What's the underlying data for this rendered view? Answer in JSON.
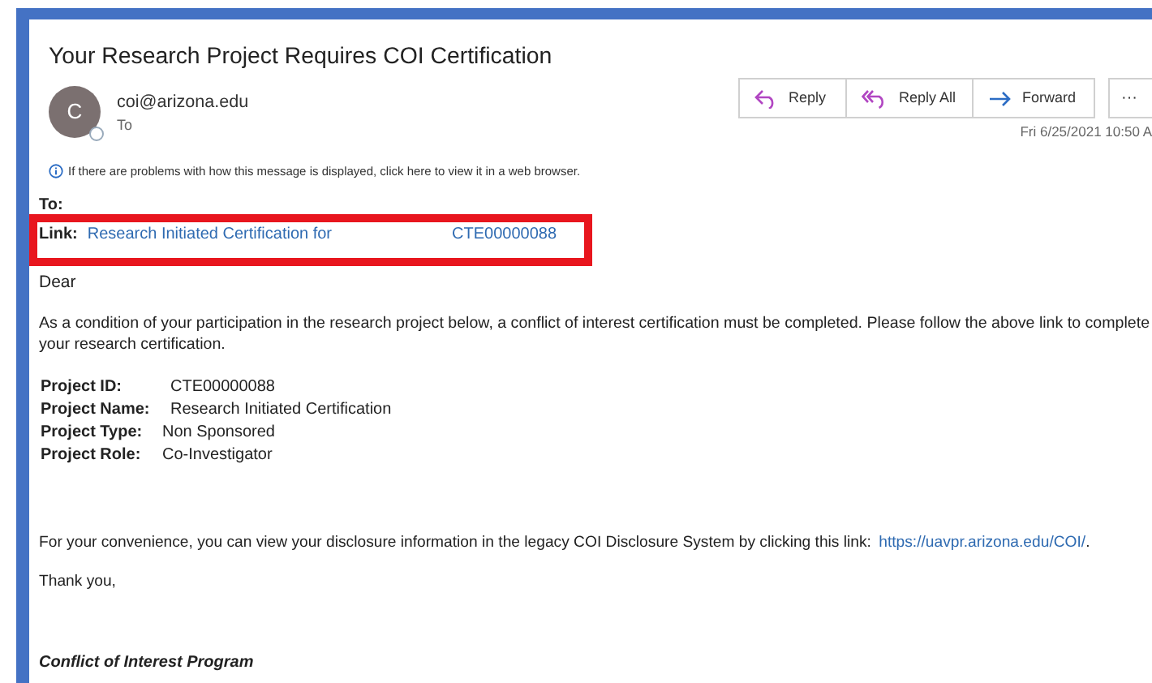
{
  "subject": "Your Research Project Requires COI Certification",
  "sender": {
    "initial": "C",
    "address": "coi@arizona.edu",
    "to_label": "To"
  },
  "actions": [
    {
      "kind": "reply",
      "label": "Reply"
    },
    {
      "kind": "reply_all",
      "label": "Reply All"
    },
    {
      "kind": "forward",
      "label": "Forward"
    }
  ],
  "more": "···",
  "date": "Fri 6/25/2021 10:50 A",
  "info_bar": "If there are problems with how this message is displayed, click here to view it in a web browser.",
  "to_field": {
    "label": "To:"
  },
  "link_field": {
    "label": "Link:",
    "link_text": "Research Initiated Certification for",
    "link_id": "CTE00000088"
  },
  "greeting": "Dear",
  "intro_lines": [
    "As a condition of your participation in the research project below, a conflict of interest certification must be completed. Please follow the above link to complete",
    "your research certification."
  ],
  "project": [
    {
      "label": "Project ID:",
      "value": "CTE00000088"
    },
    {
      "label": "Project Name:",
      "value": "Research Initiated Certification"
    },
    {
      "label": "Project Type:",
      "value": "Non Sponsored"
    },
    {
      "label": "Project Role:",
      "value": "Co-Investigator"
    }
  ],
  "convenience": {
    "text": "For your convenience, you can view your disclosure information in the legacy COI Disclosure System by clicking this link:",
    "link": "https://uavpr.arizona.edu/COI/",
    "after": "."
  },
  "thanks": "Thank you,",
  "signature": "Conflict of Interest Program"
}
